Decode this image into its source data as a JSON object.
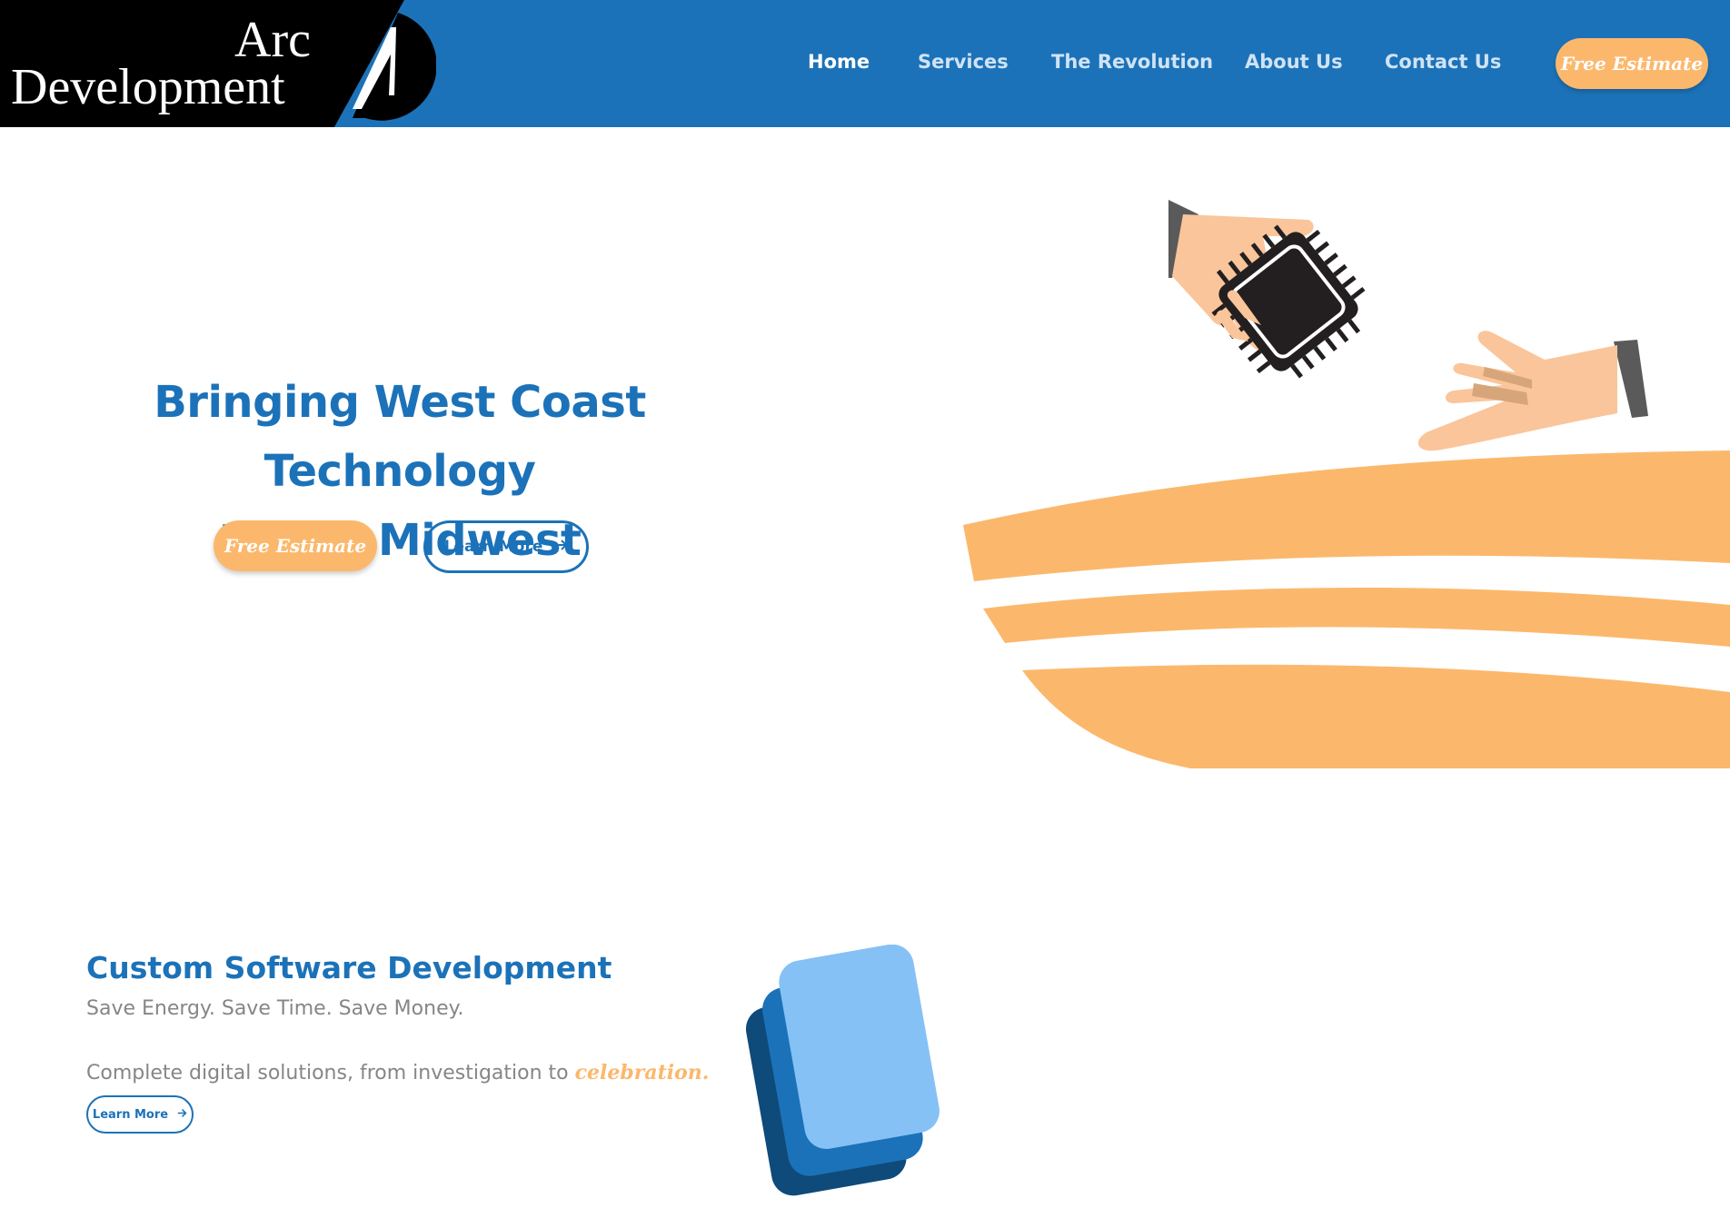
{
  "header": {
    "logo": {
      "line1": "Arc",
      "line2": "Development"
    },
    "nav": [
      {
        "label": "Home",
        "active": true
      },
      {
        "label": "Services",
        "active": false
      },
      {
        "label": "The Revolution",
        "active": false
      },
      {
        "label": "About Us",
        "active": false
      },
      {
        "label": "Contact Us",
        "active": false
      }
    ],
    "cta_label": "Free Estimate"
  },
  "hero": {
    "title_line1": "Bringing West Coast Technology",
    "title_line2": "to the Midwest",
    "cta_label": "Free Estimate",
    "learn_more_label": "Learn More",
    "illustration": "hands-exchanging-microchip"
  },
  "services": {
    "title": "Custom Software Development",
    "subtitle": "Save Energy. Save Time. Save Money.",
    "description": "Complete digital solutions, from investigation to",
    "accent_word": "celebration.",
    "learn_more_label": "Learn More",
    "icon": "stacked-cards-icon"
  },
  "colors": {
    "primary_blue": "#1c72b8",
    "accent_orange": "#fbb86c",
    "text_gray": "#868686",
    "logo_black": "#000000"
  },
  "icons": {
    "arrow": "arrow-right-icon",
    "logo_mark": "arc-logo-icon"
  }
}
